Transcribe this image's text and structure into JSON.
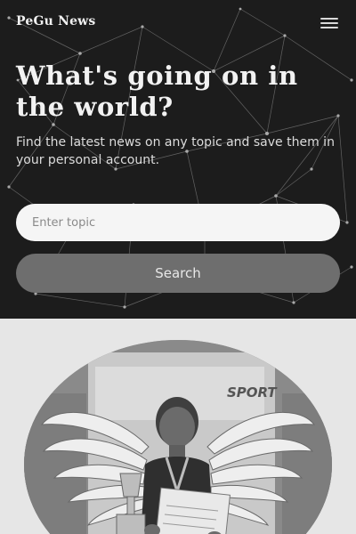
{
  "header": {
    "brand": "PeGu News",
    "menu_icon": "hamburger-menu-icon"
  },
  "hero": {
    "headline": "What's going on in the world?",
    "subtitle": "Find the latest news on any topic and save them in your personal account."
  },
  "search": {
    "placeholder": "Enter topic",
    "value": "",
    "button_label": "Search"
  },
  "news_image": {
    "icon": "news-photo",
    "banner_text": "SPORT"
  }
}
